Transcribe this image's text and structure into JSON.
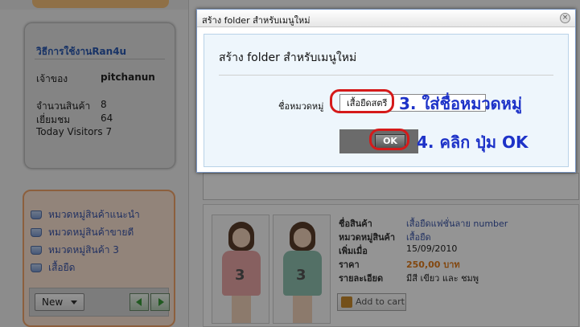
{
  "sidebar": {
    "info": {
      "title": "วิธีการใช้งานRan4u",
      "owner_label": "เจ้าของ",
      "owner_value": "pitchanun",
      "items_label": "จำนวนสินค้า",
      "items_value": "8",
      "visits_label": "เยี่ยมชม",
      "visits_value": "64",
      "today_label": "Today Visitors",
      "today_value": "7"
    },
    "categories": [
      {
        "label": "หมวดหมู่สินค้าแนะนำ"
      },
      {
        "label": "หมวดหมู่สินค้าขายดี"
      },
      {
        "label": "หมวดหมู่สินค้า 3"
      },
      {
        "label": "เสื้อยืด"
      }
    ],
    "new_button_label": "New"
  },
  "product": {
    "name_label": "ชื่อสินค้า",
    "name_value": "เสื้อยืดแฟชั่นลาย number",
    "category_label": "หมวดหมู่สินค้า",
    "category_value": "เสื้อยืด",
    "added_label": "เพิ่มเมื่อ",
    "added_value": "15/09/2010",
    "price_label": "ราคา",
    "price_value": "250,00 บาท",
    "details_label": "รายละเอียด",
    "details_value": "มีสี เขียว และ ชมพู",
    "add_to_cart_label": "Add to cart"
  },
  "dialog": {
    "title": "สร้าง folder สำหรับเมนูใหม่",
    "heading": "สร้าง folder สำหรับเมนูใหม่",
    "field_label": "ชื่อหมวดหมู่",
    "field_value": "เสื้อยืดสตรี",
    "ok_label": "OK",
    "close_glyph": "×"
  },
  "annotations": {
    "step3": "3. ใส่ชื่อหมวดหมู่",
    "step4": "4. คลิก ปุ่ม OK"
  },
  "colors": {
    "annotation_text": "#1d32c8",
    "annotation_ring": "#d51a1a",
    "link_blue": "#3a55a8",
    "price_orange": "#e07a1a"
  }
}
